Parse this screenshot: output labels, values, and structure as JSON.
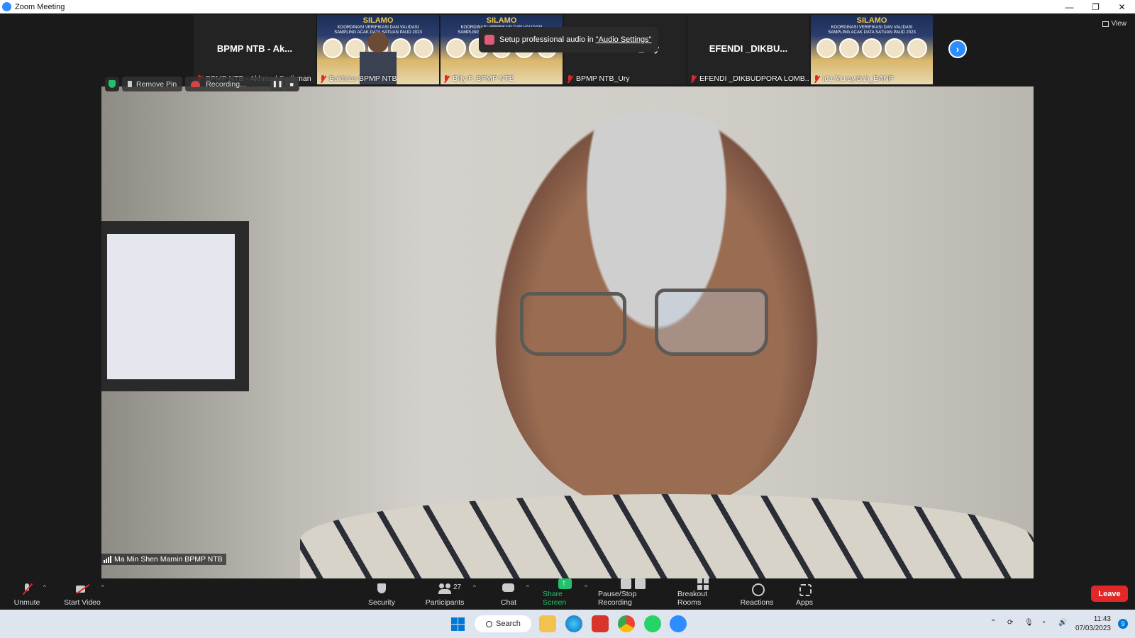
{
  "window": {
    "title": "Zoom Meeting",
    "controls": [
      "—",
      "❐",
      "✕"
    ]
  },
  "gallery": {
    "tiles": [
      {
        "display_name": "BPMP NTB - Ak...",
        "label": "BPMP NTB - Akhmad Sudirman",
        "video": false
      },
      {
        "label": "Bakhtiar-BPMP NTB",
        "video": true,
        "poster_title": "SILAMO",
        "poster_subtitle": "KOORDINASI VERIFIKASI DAN VALIDASI SAMPLING ACAK DATA SATUAN PAUD 2023"
      },
      {
        "label": "Billy F. BPMP NTB",
        "video": true,
        "poster_title": "SILAMO",
        "poster_subtitle": "KOORDINASI VERIFIKASI DAN VALIDASI SAMPLING ACAK DATA SATUAN PAUD 2023"
      },
      {
        "display_name": "BPMP NTB_Ury",
        "label": "BPMP NTB_Ury",
        "video": false
      },
      {
        "display_name": "EFENDI _DIKBU...",
        "label": "EFENDI _DIKBUDPORA LOMB...",
        "video": false
      },
      {
        "label": "ida Mursyidah_BANP",
        "video": true,
        "poster_title": "SILAMO",
        "poster_subtitle": "KOORDINASI VERIFIKASI DAN VALIDASI SAMPLING ACAK DATA SATUAN PAUD 2023"
      }
    ],
    "view_label": "View"
  },
  "tooltip": {
    "text": "Setup professional audio in",
    "link": "\"Audio Settings\""
  },
  "video_controls": {
    "remove_pin": "Remove Pin",
    "recording": "Recording...",
    "pause_glyph": "❚❚",
    "stop_glyph": "■"
  },
  "speaker": {
    "name": "Ma Min Shen Mamin BPMP NTB"
  },
  "toolbar": {
    "unmute": "Unmute",
    "start_video": "Start Video",
    "security": "Security",
    "participants": "Participants",
    "participant_count": "27",
    "chat": "Chat",
    "share_screen": "Share Screen",
    "pause_stop_recording": "Pause/Stop Recording",
    "breakout_rooms": "Breakout Rooms",
    "reactions": "Reactions",
    "apps": "Apps",
    "leave": "Leave",
    "caret": "^"
  },
  "taskbar": {
    "search": "Search",
    "time": "11:43",
    "date": "07/03/2023",
    "notifications": "9"
  },
  "colors": {
    "zoom_blue": "#2d8cff",
    "leave_red": "#e02828",
    "share_green": "#23c16b"
  }
}
